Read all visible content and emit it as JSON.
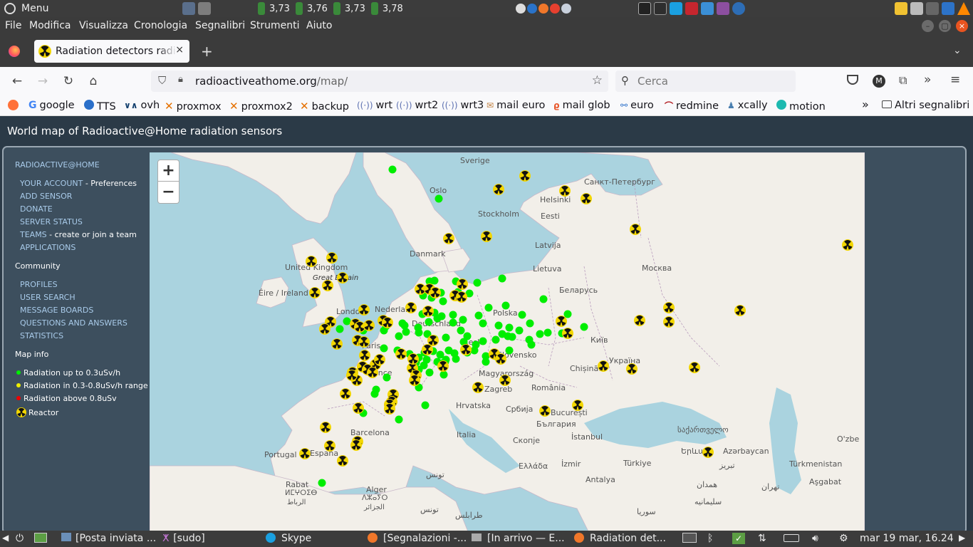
{
  "top_panel": {
    "menu_label": "Menu",
    "cpu": [
      "3,73",
      "3,76",
      "3,73",
      "3,78"
    ]
  },
  "menubar": [
    "File",
    "Modifica",
    "Visualizza",
    "Cronologia",
    "Segnalibri",
    "Strumenti",
    "Aiuto"
  ],
  "tab": {
    "title": "Radiation detectors radioa",
    "close": "×",
    "new_tab": "+"
  },
  "nav": {
    "url_host": "radioactiveathome.org",
    "url_path": "/map/",
    "search_placeholder": "Cerca"
  },
  "bookmarks": [
    "google",
    "TTS",
    "ovh",
    "proxmox",
    "proxmox2",
    "backup",
    "wrt",
    "wrt2",
    "wrt3",
    "mail euro",
    "mail glob",
    "euro",
    "redmine",
    "xcally",
    "motion"
  ],
  "bookmarks_other": "Altri segnalibri",
  "page": {
    "title": "World map of Radioactive@Home radiation sensors"
  },
  "sidebar": {
    "brand": "RADIOACTIVE@HOME",
    "account_link": "YOUR ACCOUNT",
    "account_suffix": " - Preferences",
    "add_sensor": "ADD SENSOR",
    "donate": "DONATE",
    "server_status": "SERVER STATUS",
    "teams_link": "TEAMS",
    "teams_suffix": " - create or join a team",
    "applications": "APPLICATIONS",
    "community_heading": "Community",
    "profiles": "PROFILES",
    "user_search": "USER SEARCH",
    "message_boards": "MESSAGE BOARDS",
    "qa": "QUESTIONS AND ANSWERS",
    "statistics": "STATISTICS",
    "mapinfo_heading": "Map info",
    "legend_low": "Radiation up to 0.3uSv/h",
    "legend_mid": "Radiation in 0.3-0.8uSv/h range",
    "legend_high": "Radiation above 0.8uSv",
    "legend_reactor": "Reactor",
    "colors": {
      "low": "#00ee00",
      "mid": "#eeee00",
      "high": "#ee0000"
    }
  },
  "map": {
    "zoom_in": "+",
    "zoom_out": "−",
    "labels": {
      "sverige": "Sverige",
      "oslo": "Oslo",
      "stockholm": "Stockholm",
      "helsinki": "Helsinki",
      "spb": "Санкт-Петербург",
      "eesti": "Eesti",
      "latvija": "Latvija",
      "moskva": "Москва",
      "danmark": "Danmark",
      "lietuva": "Lietuva",
      "uk": "United Kingdom",
      "gb": "Great Britain",
      "eire": "Éire / Ireland",
      "belarus": "Беларусь",
      "london": "London",
      "nederland": "Nederland",
      "polska": "Polska",
      "deutschland": "Deutschland",
      "paris": "Paris",
      "cesko": "Česko",
      "kyiv": "Київ",
      "slovensko": "Slovensko",
      "ukraina": "Україна",
      "france": "France",
      "magyar": "Magyarország",
      "chisinau": "Chișinău",
      "zagreb": "Zagreb",
      "romania": "România",
      "hrvatska": "Hrvatska",
      "srbija": "Србија",
      "bucuresti": "București",
      "bulgaria": "България",
      "georgia": "საქართველო",
      "barcelona": "Barcelona",
      "italia": "Italia",
      "skopje": "Скопје",
      "istanbul": "İstanbul",
      "yerevan": "Երևան",
      "azerbaycan": "Azərbaycan",
      "portugal": "Portugal",
      "espana": "España",
      "ellada": "Ελλάδα",
      "izmir": "İzmir",
      "turkiye": "Türkiye",
      "turkmenistan": "Türkmenistan",
      "ashgabat": "Aşgabat",
      "rabat": "Rabat",
      "tamazight": "ⵍⵎⵖⵔⵉⴱ",
      "rabat_ar": "الرباط",
      "alger": "Alger",
      "alger_tz": "ⴷⵣⴰⵢⵔ",
      "alger_ar": "الجزائر",
      "tunis": "تونس",
      "tunis2": "تونس",
      "antalya": "Antalya",
      "tabriz": "تبریز",
      "tehran": "تهران",
      "hamadan": "همدان",
      "soleymaniyeh": "سلیمانیه",
      "syria": "سوريا",
      "libya": "طرابلس",
      "ozbek": "O'zbe",
      "ukraina_dnipro": ""
    }
  },
  "taskbar": {
    "items": [
      "[Posta inviata ...",
      "[sudo]",
      "Skype",
      "[Segnalazioni -...",
      "[In arrivo — E...",
      "Radiation det..."
    ],
    "clock": "mar 19 mar, 16.24"
  }
}
